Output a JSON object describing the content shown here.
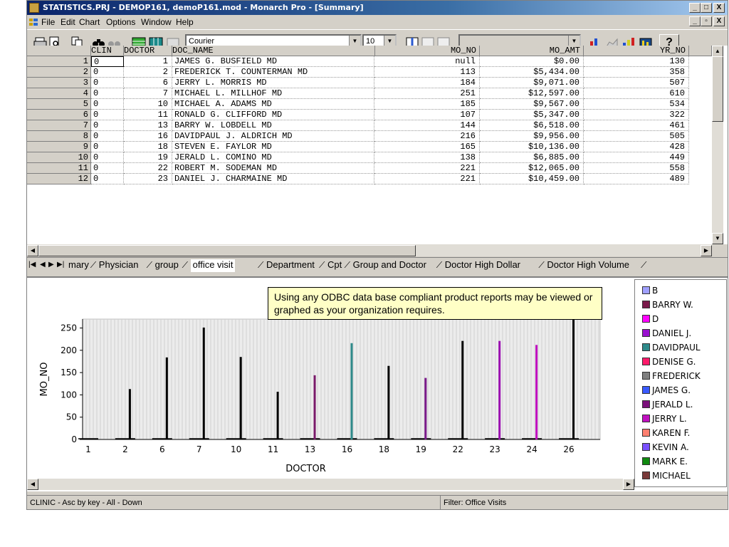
{
  "window": {
    "title": "STATISTICS.PRJ - DEMOP161, demoP161.mod - Monarch Pro - [Summary]",
    "controls": [
      "_",
      "□",
      "X"
    ],
    "child_controls": [
      "_",
      "▫",
      "X"
    ]
  },
  "menu": [
    "File",
    "Edit",
    "Chart",
    "Options",
    "Window",
    "Help"
  ],
  "toolbar": {
    "font_name": "Courier",
    "font_size": "10",
    "help_label": "?"
  },
  "table": {
    "columns": [
      "CLIN",
      "DOCTOR",
      "DOC_NAME",
      "MO_NO",
      "MO_AMT",
      "YR_NO"
    ],
    "rows": [
      {
        "n": "1",
        "clin": "0",
        "doctor": "1",
        "name": "JAMES G. BUSFIELD MD",
        "mo_no": "null",
        "mo_amt": "$0.00",
        "yr_no": "130"
      },
      {
        "n": "2",
        "clin": "0",
        "doctor": "2",
        "name": "FREDERICK T. COUNTERMAN MD",
        "mo_no": "113",
        "mo_amt": "$5,434.00",
        "yr_no": "358"
      },
      {
        "n": "3",
        "clin": "0",
        "doctor": "6",
        "name": "JERRY L. MORRIS MD",
        "mo_no": "184",
        "mo_amt": "$9,071.00",
        "yr_no": "507"
      },
      {
        "n": "4",
        "clin": "0",
        "doctor": "7",
        "name": "MICHAEL L. MILLHOF MD",
        "mo_no": "251",
        "mo_amt": "$12,597.00",
        "yr_no": "610"
      },
      {
        "n": "5",
        "clin": "0",
        "doctor": "10",
        "name": "MICHAEL A. ADAMS MD",
        "mo_no": "185",
        "mo_amt": "$9,567.00",
        "yr_no": "534"
      },
      {
        "n": "6",
        "clin": "0",
        "doctor": "11",
        "name": "RONALD G. CLIFFORD MD",
        "mo_no": "107",
        "mo_amt": "$5,347.00",
        "yr_no": "322"
      },
      {
        "n": "7",
        "clin": "0",
        "doctor": "13",
        "name": "BARRY W. LOBDELL MD",
        "mo_no": "144",
        "mo_amt": "$6,518.00",
        "yr_no": "461"
      },
      {
        "n": "8",
        "clin": "0",
        "doctor": "16",
        "name": "DAVIDPAUL J. ALDRICH MD",
        "mo_no": "216",
        "mo_amt": "$9,956.00",
        "yr_no": "505"
      },
      {
        "n": "9",
        "clin": "0",
        "doctor": "18",
        "name": "STEVEN E. FAYLOR MD",
        "mo_no": "165",
        "mo_amt": "$10,136.00",
        "yr_no": "428"
      },
      {
        "n": "10",
        "clin": "0",
        "doctor": "19",
        "name": "JERALD L. COMINO MD",
        "mo_no": "138",
        "mo_amt": "$6,885.00",
        "yr_no": "449"
      },
      {
        "n": "11",
        "clin": "0",
        "doctor": "22",
        "name": "ROBERT M. SODEMAN MD",
        "mo_no": "221",
        "mo_amt": "$12,065.00",
        "yr_no": "558"
      },
      {
        "n": "12",
        "clin": "0",
        "doctor": "23",
        "name": "DANIEL J. CHARMAINE MD",
        "mo_no": "221",
        "mo_amt": "$10,459.00",
        "yr_no": "489"
      }
    ]
  },
  "tabs": [
    "mary",
    "Physician",
    "group",
    "office visit",
    "Department",
    "Cpt",
    "Group and Doctor",
    "Doctor High Dollar",
    "Doctor High Volume"
  ],
  "active_tab": "office visit",
  "note": "Using any ODBC data base compliant product reports may be viewed or graphed as your organization requires.",
  "chart_data": {
    "type": "bar",
    "xlabel": "DOCTOR",
    "ylabel": "MO_NO",
    "ylim": [
      0,
      270
    ],
    "yticks": [
      0,
      50,
      100,
      150,
      200,
      250
    ],
    "categories": [
      "1",
      "2",
      "6",
      "7",
      "10",
      "11",
      "13",
      "16",
      "18",
      "19",
      "22",
      "23",
      "24",
      "26"
    ],
    "values": [
      0,
      113,
      184,
      251,
      185,
      107,
      144,
      216,
      165,
      138,
      221,
      221,
      212,
      270
    ],
    "bar_colors": [
      "#000000",
      "#000000",
      "#000000",
      "#000000",
      "#000000",
      "#000000",
      "#7a1a6a",
      "#2e8a8a",
      "#000000",
      "#7a1a8a",
      "#000000",
      "#9a10b0",
      "#c010c0",
      "#000000"
    ],
    "grid": true,
    "legend_position": "right"
  },
  "legend": [
    {
      "label": "B",
      "color": "#a0a0ff"
    },
    {
      "label": "BARRY W.",
      "color": "#7a1a4a"
    },
    {
      "label": "D",
      "color": "#ff00ff"
    },
    {
      "label": "DANIEL J.",
      "color": "#9a10d0"
    },
    {
      "label": "DAVIDPAUL",
      "color": "#2e8a8a"
    },
    {
      "label": "DENISE G.",
      "color": "#ff1a6a"
    },
    {
      "label": "FREDERICK",
      "color": "#808080"
    },
    {
      "label": "JAMES G.",
      "color": "#3a5aff"
    },
    {
      "label": "JERALD L.",
      "color": "#7a107a"
    },
    {
      "label": "JERRY L.",
      "color": "#c010c0"
    },
    {
      "label": "KAREN F.",
      "color": "#ff8070"
    },
    {
      "label": "KEVIN A.",
      "color": "#7a50ff"
    },
    {
      "label": "MARK E.",
      "color": "#108a10"
    },
    {
      "label": "MICHAEL",
      "color": "#7a3a3a"
    }
  ],
  "status": {
    "left": "CLINIC - Asc by key - All - Down",
    "filter": "Filter: Office Visits"
  }
}
